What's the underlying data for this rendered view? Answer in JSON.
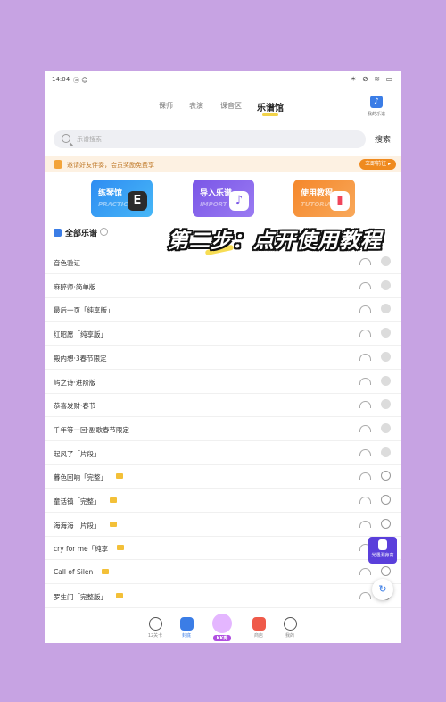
{
  "status": {
    "time": "14:04",
    "extra": "ⓐ 😊",
    "icons": "✶ ⊘ ≋ ▭"
  },
  "topnav": {
    "tabs": [
      "课师",
      "表演",
      "课音区",
      "乐谱馆"
    ],
    "my_music": "我的乐谱"
  },
  "search": {
    "placeholder": "乐谱搜索",
    "button": "搜索"
  },
  "notice": {
    "text": "邀请好友伴奏，会员奖励免费享",
    "button": "立即前往 ▸"
  },
  "cards": [
    {
      "title": "练琴馆",
      "en": "PRACTICE",
      "icon": "E"
    },
    {
      "title": "导入乐谱",
      "en": "IMPORT",
      "icon": "♪"
    },
    {
      "title": "使用教程",
      "en": "TUTORIAL",
      "icon": "▮"
    }
  ],
  "section": {
    "title": "全部乐谱"
  },
  "songs": [
    {
      "name": "音色验证",
      "action": "check",
      "crown": false
    },
    {
      "name": "麻醉师·简单版",
      "action": "check",
      "crown": false
    },
    {
      "name": "最后一页「纯享版」",
      "action": "check",
      "crown": false
    },
    {
      "name": "红昭愿「纯享版」",
      "action": "check",
      "crown": false
    },
    {
      "name": "殿内想·3春节限定",
      "action": "check",
      "crown": false
    },
    {
      "name": "屿之诗·进阶版",
      "action": "check",
      "crown": false
    },
    {
      "name": "恭喜发财·春节",
      "action": "check",
      "crown": false
    },
    {
      "name": "千年等一回·副歌春节限定",
      "action": "check",
      "crown": false
    },
    {
      "name": "起风了「片段」",
      "action": "check",
      "crown": false
    },
    {
      "name": "暮色回响「完整」",
      "action": "download",
      "crown": true
    },
    {
      "name": "童话镇「完整」",
      "action": "download",
      "crown": true
    },
    {
      "name": "海海海「片段」",
      "action": "download",
      "crown": true
    },
    {
      "name": "cry for me「纯享",
      "action": "download",
      "crown": true
    },
    {
      "name": "Call of Silen",
      "action": "download",
      "crown": true
    },
    {
      "name": "罗生门「完整版」",
      "action": "download",
      "crown": true
    }
  ],
  "floating": {
    "label": "光遇测身高"
  },
  "bottomnav": [
    "12关卡",
    "封底",
    "KK秀",
    "商店",
    "我的"
  ],
  "overlay": {
    "text": "第二步：点开使用教程"
  }
}
